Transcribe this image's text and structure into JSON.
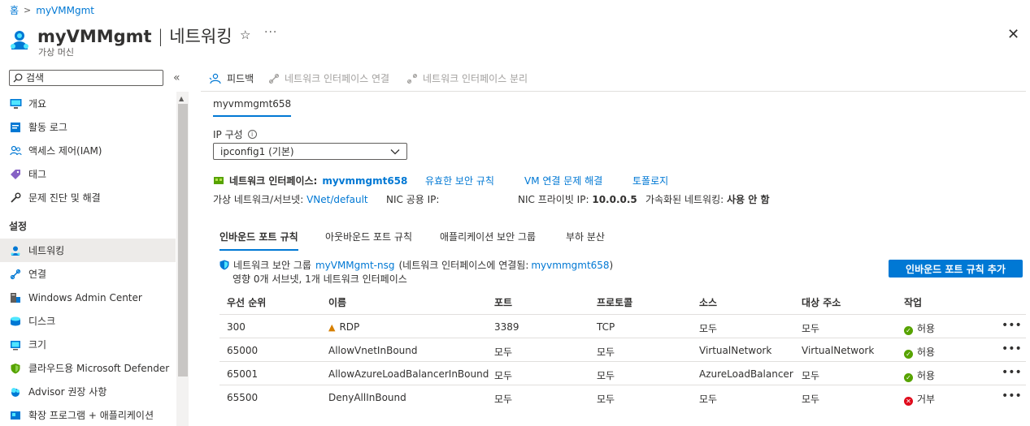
{
  "breadcrumb": {
    "home": "홈",
    "current": "myVMMgmt"
  },
  "header": {
    "resource_name": "myVMMgmt",
    "separator": "|",
    "section": "네트워킹",
    "subtitle": "가상 머신",
    "favorite_glyph": "☆",
    "more_glyph": "···",
    "close_glyph": "✕"
  },
  "sidebar": {
    "search_placeholder": "검색",
    "collapse_glyph": "«",
    "items": [
      {
        "label": "개요",
        "icon": "monitor-icon"
      },
      {
        "label": "활동 로그",
        "icon": "log-icon"
      },
      {
        "label": "액세스 제어(IAM)",
        "icon": "people-icon"
      },
      {
        "label": "태그",
        "icon": "tag-icon"
      },
      {
        "label": "문제 진단 및 해결",
        "icon": "wrench-icon"
      }
    ],
    "settings_label": "설정",
    "settings_items": [
      {
        "label": "네트워킹",
        "icon": "networking-icon",
        "active": true
      },
      {
        "label": "연결",
        "icon": "connect-icon"
      },
      {
        "label": "Windows Admin Center",
        "icon": "admin-center-icon"
      },
      {
        "label": "디스크",
        "icon": "disk-icon"
      },
      {
        "label": "크기",
        "icon": "size-icon"
      },
      {
        "label": "클라우드용 Microsoft Defender",
        "icon": "defender-icon"
      },
      {
        "label": "Advisor 권장 사항",
        "icon": "advisor-icon"
      },
      {
        "label": "확장 프로그램 + 애플리케이션",
        "icon": "extensions-icon"
      }
    ]
  },
  "toolbar": {
    "feedback": "피드백",
    "attach": "네트워크 인터페이스 연결",
    "detach": "네트워크 인터페이스 분리"
  },
  "nic_tab": "myvmmgmt658",
  "ip_config": {
    "label": "IP 구성",
    "info_glyph": "i",
    "selected": "ipconfig1 (기본)"
  },
  "nic": {
    "label": "네트워크 인터페이스:",
    "name": "myvmmgmt658",
    "effective_rules": "유효한 보안 규칙",
    "troubleshoot": "VM 연결 문제 해결",
    "topology": "토폴로지",
    "vnet_label": "가상 네트워크/서브넷:",
    "vnet_value": "VNet/default",
    "public_ip_label": "NIC 공용 IP:",
    "private_ip_label": "NIC 프라이빗 IP:",
    "private_ip_value": "10.0.0.5",
    "accel_label": "가속화된 네트워킹:",
    "accel_value": "사용 안 함"
  },
  "rule_tabs": [
    "인바운드 포트 규칙",
    "아웃바운드 포트 규칙",
    "애플리케이션 보안 그룹",
    "부하 분산"
  ],
  "nsg": {
    "prefix": "네트워크 보안 그룹",
    "name": "myVMMgmt-nsg",
    "attached_prefix": "(네트워크 인터페이스에 연결됨:",
    "attached_nic": "myvmmgmt658",
    "attached_suffix": ")",
    "impact": "영향 0개 서브넷, 1개 네트워크 인터페이스"
  },
  "add_rule_button": "인바운드 포트 규칙 추가",
  "table": {
    "headers": [
      "우선 순위",
      "이름",
      "포트",
      "프로토콜",
      "소스",
      "대상 주소",
      "작업"
    ],
    "rows": [
      {
        "priority": "300",
        "name": "RDP",
        "warn": true,
        "port": "3389",
        "protocol": "TCP",
        "source": "모두",
        "destination": "모두",
        "action": "허용",
        "allow": true
      },
      {
        "priority": "65000",
        "name": "AllowVnetInBound",
        "warn": false,
        "port": "모두",
        "protocol": "모두",
        "source": "VirtualNetwork",
        "destination": "VirtualNetwork",
        "action": "허용",
        "allow": true
      },
      {
        "priority": "65001",
        "name": "AllowAzureLoadBalancerInBound",
        "warn": false,
        "port": "모두",
        "protocol": "모두",
        "source": "AzureLoadBalancer",
        "destination": "모두",
        "action": "허용",
        "allow": true
      },
      {
        "priority": "65500",
        "name": "DenyAllInBound",
        "warn": false,
        "port": "모두",
        "protocol": "모두",
        "source": "모두",
        "destination": "모두",
        "action": "거부",
        "allow": false
      }
    ],
    "more_glyph": "•••"
  },
  "colors": {
    "accent": "#0078d4",
    "allow": "#57a300",
    "deny": "#e00b1c",
    "warning": "#d67f00"
  }
}
